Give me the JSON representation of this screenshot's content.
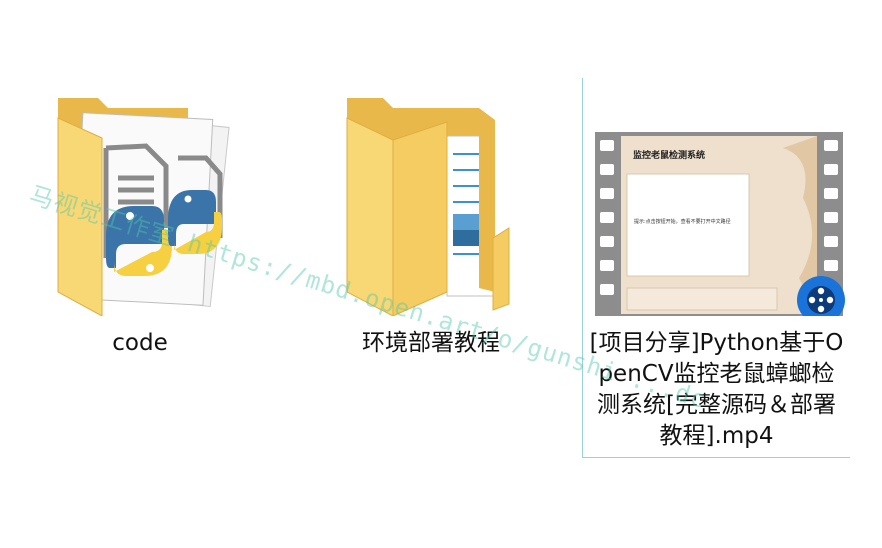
{
  "files": [
    {
      "label": "code",
      "icon": "python-folder-icon"
    },
    {
      "label": "环境部署教程",
      "icon": "document-folder-icon"
    },
    {
      "label": "[项目分享]Python基于OpenCV监控老鼠蟑螂检测系统[完整源码＆部署教程].mp4",
      "icon": "video-thumbnail-icon",
      "selected": true
    }
  ],
  "thumbnail": {
    "title": "监控老鼠检测系统",
    "body_text": "提示:点击按钮开始，查看不要打开中文路径"
  },
  "watermark": "马视觉工作室 https://mbd.open.art/o/gunshi ...dc",
  "colors": {
    "folder_light": "#f8d775",
    "folder_dark": "#e8b94a",
    "selection_border": "#99d1df",
    "python_blue": "#3a74a8",
    "python_yellow": "#f6d040",
    "player_blue": "#1a73d9"
  }
}
